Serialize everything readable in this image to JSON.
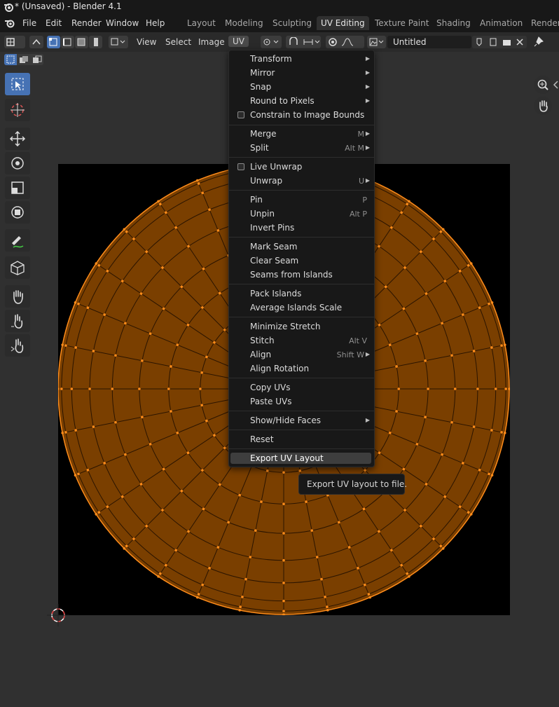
{
  "window": {
    "title": "* (Unsaved) - Blender 4.1"
  },
  "menubar": {
    "items": [
      "File",
      "Edit",
      "Render",
      "Window",
      "Help"
    ]
  },
  "workspaces": {
    "tabs": [
      "Layout",
      "Modeling",
      "Sculpting",
      "UV Editing",
      "Texture Paint",
      "Shading",
      "Animation",
      "Renderi"
    ],
    "active": "UV Editing"
  },
  "header": {
    "menus": [
      "View",
      "Select",
      "Image",
      "UV"
    ],
    "image_name": "Untitled"
  },
  "uv_menu": {
    "items": [
      {
        "label": "Transform",
        "submenu": true
      },
      {
        "label": "Mirror",
        "submenu": true
      },
      {
        "label": "Snap",
        "submenu": true
      },
      {
        "label": "Round to Pixels",
        "submenu": true
      },
      {
        "label": "Constrain to Image Bounds",
        "checkbox": true
      },
      {
        "label": "Merge",
        "shortcut": "M",
        "submenu": true
      },
      {
        "label": "Split",
        "shortcut": "Alt M",
        "submenu": true
      },
      {
        "label": "Live Unwrap",
        "checkbox": true
      },
      {
        "label": "Unwrap",
        "shortcut": "U",
        "submenu": true
      },
      {
        "label": "Pin",
        "shortcut": "P"
      },
      {
        "label": "Unpin",
        "shortcut": "Alt P"
      },
      {
        "label": "Invert Pins"
      },
      {
        "label": "Mark Seam"
      },
      {
        "label": "Clear Seam"
      },
      {
        "label": "Seams from Islands"
      },
      {
        "label": "Pack Islands"
      },
      {
        "label": "Average Islands Scale"
      },
      {
        "label": "Minimize Stretch"
      },
      {
        "label": "Stitch",
        "shortcut": "Alt V"
      },
      {
        "label": "Align",
        "shortcut": "Shift W",
        "submenu": true
      },
      {
        "label": "Align Rotation"
      },
      {
        "label": "Copy UVs"
      },
      {
        "label": "Paste UVs"
      },
      {
        "label": "Show/Hide Faces",
        "submenu": true
      },
      {
        "label": "Reset"
      },
      {
        "label": "Export UV Layout",
        "highlighted": true
      }
    ]
  },
  "tooltip": {
    "text": "Export UV layout to file."
  },
  "colors": {
    "accent": "#4672b4",
    "uv_face": "#7a3f00",
    "uv_edge": "#ff8c1a",
    "canvas": "#000000"
  },
  "tools": [
    "select-box-icon",
    "cursor-icon",
    "move-icon",
    "rotate-icon",
    "scale-icon",
    "transform-icon",
    "annotate-icon",
    "cube-add-icon",
    "grab-icon",
    "relax-icon",
    "pinch-icon"
  ]
}
